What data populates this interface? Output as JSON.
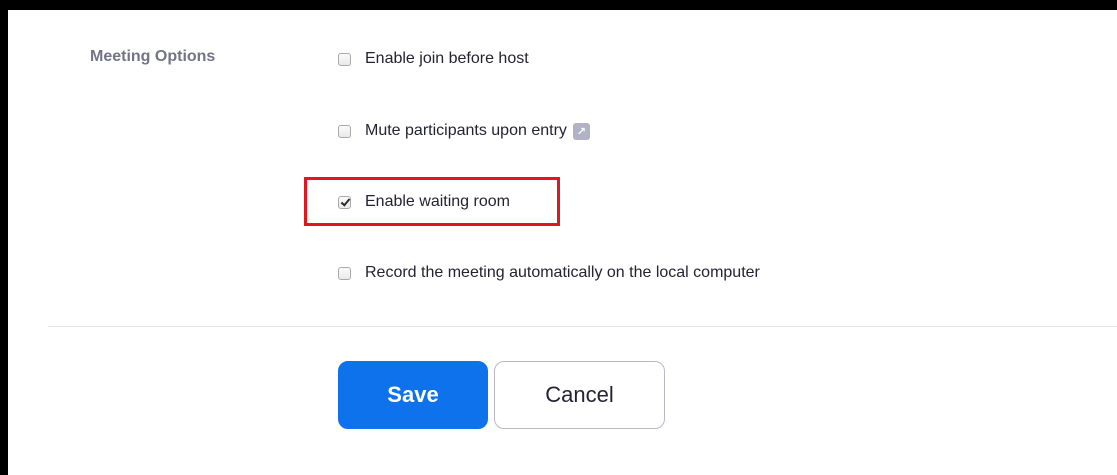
{
  "meeting_options": {
    "section_label": "Meeting Options",
    "options": [
      {
        "label": "Enable join before host",
        "checked": false
      },
      {
        "label": "Mute participants upon entry",
        "checked": false,
        "info_icon": "info-badge-icon"
      },
      {
        "label": "Enable waiting room",
        "checked": true,
        "highlighted": true
      },
      {
        "label": "Record the meeting automatically on the local computer",
        "checked": false
      }
    ]
  },
  "actions": {
    "save_label": "Save",
    "cancel_label": "Cancel"
  },
  "colors": {
    "primary": "#0e72ed",
    "highlight": "#e3161f",
    "label_gray": "#747487",
    "text": "#232333"
  }
}
